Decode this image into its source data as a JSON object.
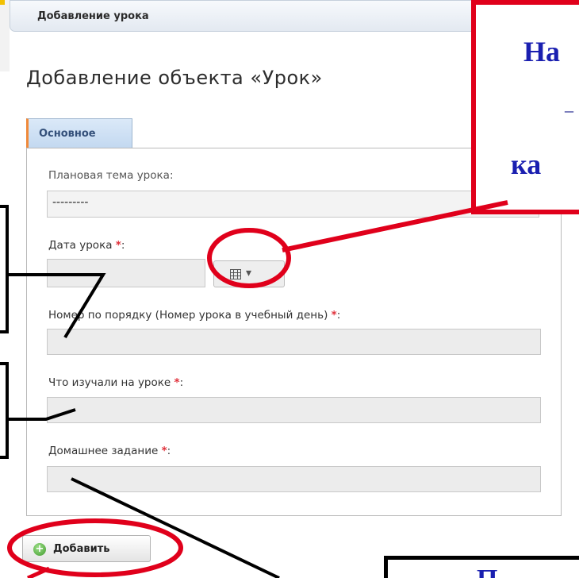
{
  "window": {
    "tab_title": "Добавление урока"
  },
  "page": {
    "title": "Добавление объекта «Урок»"
  },
  "form": {
    "tab_label": "Основное",
    "fields": {
      "topic": {
        "label": "Плановая тема урока:",
        "value": "---------"
      },
      "date": {
        "label": "Дата урока",
        "required_mark": "*",
        "suffix": ":",
        "value": ""
      },
      "number": {
        "label": "Номер по порядку (Номер урока в учебный день)",
        "required_mark": "*",
        "suffix": ":",
        "value": ""
      },
      "studied": {
        "label": "Что изучали на уроке",
        "required_mark": "*",
        "suffix": ":",
        "value": ""
      },
      "homework": {
        "label": "Домашнее задание",
        "required_mark": "*",
        "suffix": ":",
        "value": ""
      }
    },
    "calendar_icon": "calendar-grid-icon",
    "submit": {
      "label": "Добавить",
      "icon": "plus-circle-icon"
    }
  },
  "annotations": {
    "callout_top": {
      "line1": "На",
      "line2": "–",
      "line3": "ка"
    },
    "callout_bottom": {
      "text": "П"
    },
    "colors": {
      "highlight": "#e0001b",
      "callout_text": "#1a1fb0",
      "connector": "#000000"
    }
  }
}
